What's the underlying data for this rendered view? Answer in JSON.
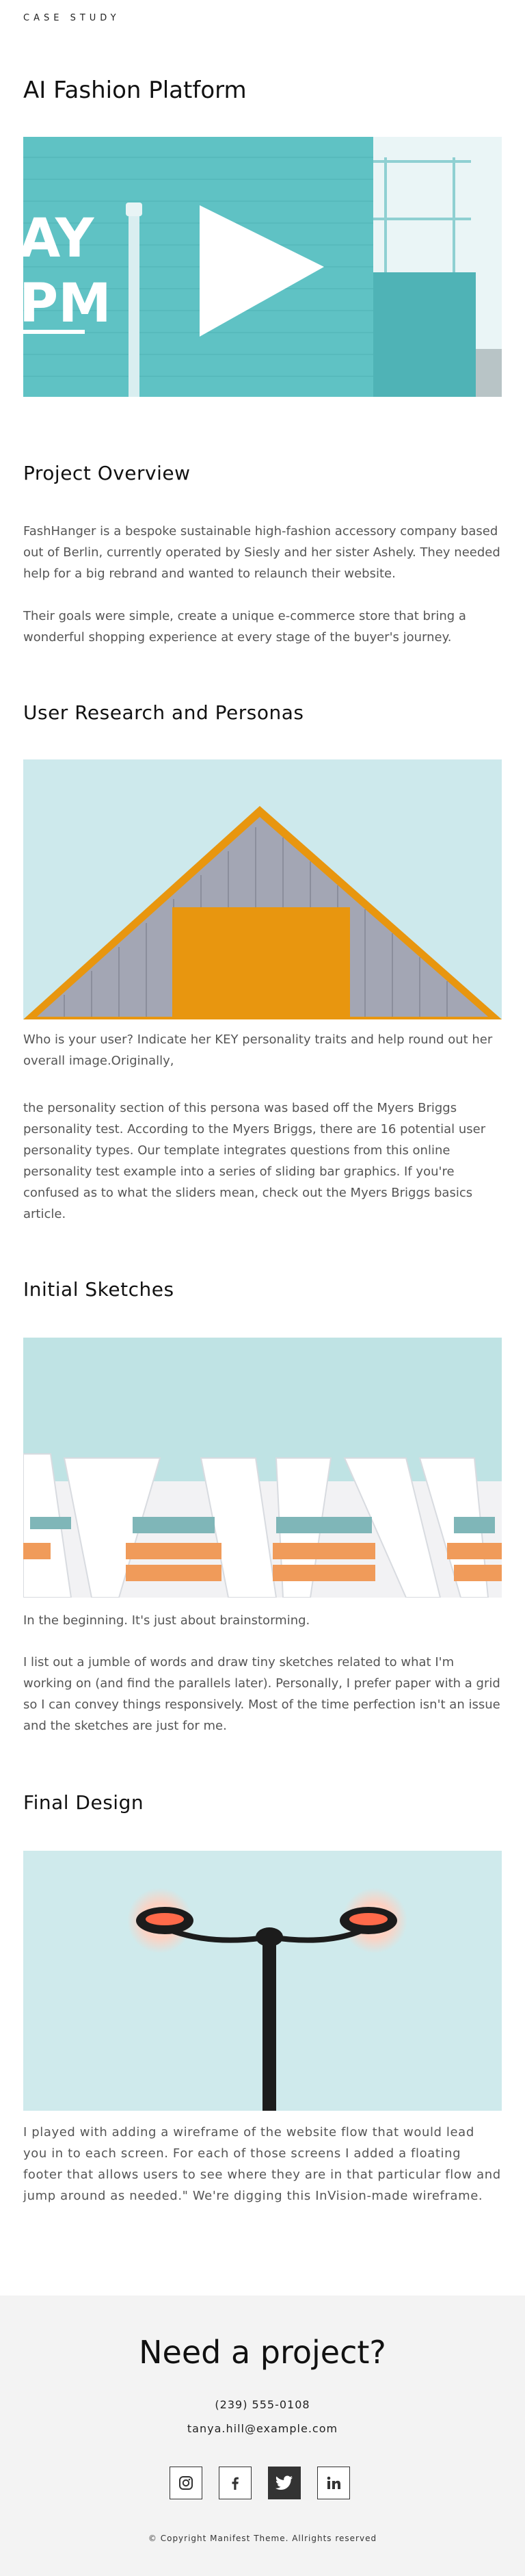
{
  "header": {
    "kicker": "CASE STUDY",
    "title": "AI Fashion Platform"
  },
  "overview": {
    "heading": "Project Overview",
    "p1": "FashHanger is a bespoke sustainable high-fashion accessory company based out of Berlin, currently operated by Siesly and her sister Ashely. They needed help for a big rebrand and wanted to relaunch their website.",
    "p2": "Their goals were simple, create a unique e-commerce store that bring a wonderful shopping experience at every stage of the buyer's journey."
  },
  "research": {
    "heading": "User Research and Personas",
    "p1": "Who is your user? Indicate her KEY personality traits and help round out her overall image.Originally,",
    "p2": "the personality section of this persona was based off the Myers Briggs personality test. According to the Myers Briggs, there are 16 potential user personality types. Our template integrates questions from this online personality test example into a series of sliding bar graphics. If you're confused as to what the sliders mean, check out the Myers Briggs basics article."
  },
  "sketches": {
    "heading": "Initial Sketches",
    "p1": "In the beginning. It's just about brainstorming.",
    "p2": "I list out a jumble of words and draw tiny sketches related to what I'm working on (and find the parallels later). Personally, I prefer paper with a grid so I can convey things responsively. Most of the time perfection isn't an issue and the sketches are just for me."
  },
  "final": {
    "heading": "Final Design",
    "p1": "I played with adding a wireframe of the website flow that would lead you in to each screen. For each of those screens I added a floating footer that allows users to see where they are in that particular flow and jump around as needed.\" We're digging this InVision-made wireframe."
  },
  "hero_sign": {
    "line1": "AY",
    "line2": "PM"
  },
  "footer": {
    "cta": "Need a project?",
    "phone": "(239) 555-0108",
    "email": "tanya.hill@example.com",
    "social": [
      "instagram-icon",
      "facebook-icon",
      "twitter-icon",
      "linkedin-icon"
    ],
    "copyright": "© Copyright Manifest Theme. Allrights reserved"
  },
  "colors": {
    "teal": "#5fc2c4",
    "orange": "#e8960f",
    "sky": "#cde9ec",
    "footer_bg": "#f3f3f3"
  }
}
